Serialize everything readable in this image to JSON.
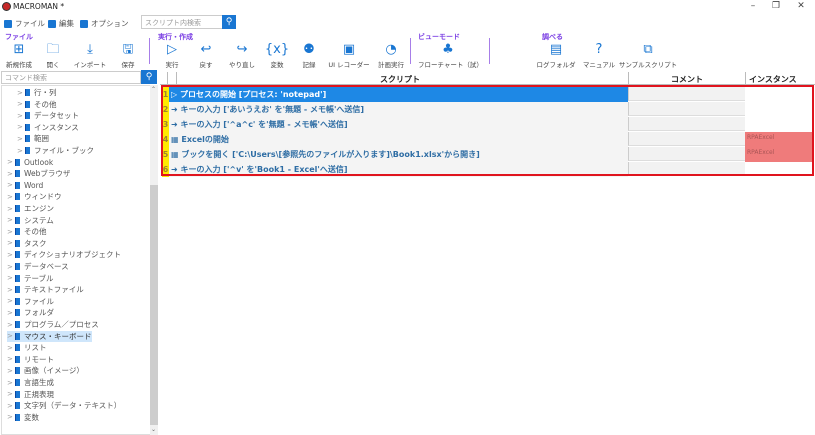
{
  "window": {
    "title": "MACROMAN *",
    "min": "–",
    "max": "❐",
    "close": "✕"
  },
  "menu": [
    {
      "label": "ファイル"
    },
    {
      "label": "編集"
    },
    {
      "label": "オプション"
    }
  ],
  "script_search": {
    "placeholder": "スクリプト内検索",
    "icon": "search-icon"
  },
  "groups": {
    "file": "ファイル",
    "run": "実行・作成",
    "view": "ビューモード",
    "lookup": "調べる"
  },
  "toolbar": [
    {
      "label": "新規作成",
      "icon": "new-file-icon",
      "glyph": "⊞"
    },
    {
      "label": "開く",
      "icon": "open-folder-icon",
      "glyph": "🗀"
    },
    {
      "label": "インポート",
      "icon": "import-icon",
      "glyph": "⤓"
    },
    {
      "label": "保存",
      "icon": "save-icon",
      "glyph": "🖫"
    },
    {
      "label": "実行",
      "icon": "play-icon",
      "glyph": "▷"
    },
    {
      "label": "戻す",
      "icon": "undo-icon",
      "glyph": "↩"
    },
    {
      "label": "やり直し",
      "icon": "redo-icon",
      "glyph": "↪"
    },
    {
      "label": "変数",
      "icon": "variable-icon",
      "glyph": "{x}"
    },
    {
      "label": "記録",
      "icon": "record-icon",
      "glyph": "⚉"
    },
    {
      "label": "UI レコーダー",
      "icon": "ui-recorder-icon",
      "glyph": "▣"
    },
    {
      "label": "計画実行",
      "icon": "schedule-icon",
      "glyph": "◔"
    },
    {
      "label": "フローチャート（試）",
      "icon": "flowchart-icon",
      "glyph": "♣"
    },
    {
      "label": "ログフォルダ",
      "icon": "log-folder-icon",
      "glyph": "▤"
    },
    {
      "label": "マニュアル",
      "icon": "help-icon",
      "glyph": "?"
    },
    {
      "label": "サンプルスクリプト",
      "icon": "sample-script-icon",
      "glyph": "⧉"
    }
  ],
  "command_search": {
    "placeholder": "コマンド検索"
  },
  "tree": [
    {
      "label": "行・列",
      "level": 1
    },
    {
      "label": "その他",
      "level": 1
    },
    {
      "label": "データセット",
      "level": 1
    },
    {
      "label": "インスタンス",
      "level": 1
    },
    {
      "label": "範囲",
      "level": 1
    },
    {
      "label": "ファイル・ブック",
      "level": 1
    },
    {
      "label": "Outlook",
      "level": 0
    },
    {
      "label": "Webブラウザ",
      "level": 0
    },
    {
      "label": "Word",
      "level": 0
    },
    {
      "label": "ウィンドウ",
      "level": 0
    },
    {
      "label": "エンジン",
      "level": 0
    },
    {
      "label": "システム",
      "level": 0
    },
    {
      "label": "その他",
      "level": 0
    },
    {
      "label": "タスク",
      "level": 0
    },
    {
      "label": "ディクショナリオブジェクト",
      "level": 0
    },
    {
      "label": "データベース",
      "level": 0
    },
    {
      "label": "テーブル",
      "level": 0
    },
    {
      "label": "テキストファイル",
      "level": 0
    },
    {
      "label": "ファイル",
      "level": 0
    },
    {
      "label": "フォルダ",
      "level": 0
    },
    {
      "label": "プログラム／プロセス",
      "level": 0
    },
    {
      "label": "マウス・キーボード",
      "level": 0,
      "selected": true
    },
    {
      "label": "リスト",
      "level": 0
    },
    {
      "label": "リモート",
      "level": 0
    },
    {
      "label": "画像（イメージ）",
      "level": 0
    },
    {
      "label": "言語生成",
      "level": 0
    },
    {
      "label": "正規表現",
      "level": 0
    },
    {
      "label": "文字列（データ・テキスト）",
      "level": 0
    },
    {
      "label": "変数",
      "level": 0
    }
  ],
  "grid": {
    "headers": {
      "script": "スクリプト",
      "comment": "コメント",
      "instance": "インスタンス"
    },
    "rows": [
      {
        "num": "1",
        "icon": "process-start-icon",
        "glyph": "▷",
        "script": "プロセスの開始 [プロセス: 'notepad']",
        "comment": "",
        "instance": "",
        "selected": true
      },
      {
        "num": "2",
        "icon": "arrow-right-icon",
        "glyph": "➜",
        "script": "キーの入力 ['あいうえお' を'無題 - メモ帳'へ送信]",
        "comment": "",
        "instance": ""
      },
      {
        "num": "3",
        "icon": "arrow-right-icon",
        "glyph": "➜",
        "script": "キーの入力 ['^a^c' を'無題 - メモ帳'へ送信]",
        "comment": "",
        "instance": ""
      },
      {
        "num": "4",
        "icon": "excel-grid-icon",
        "glyph": "▦",
        "script": "Excelの開始",
        "comment": "",
        "instance": "RPAExcel"
      },
      {
        "num": "5",
        "icon": "excel-grid-icon",
        "glyph": "▦",
        "script": "ブックを開く ['C:\\Users\\[参照先のファイルが入ります]\\Book1.xlsx'から開き]",
        "comment": "",
        "instance": "RPAExcel"
      },
      {
        "num": "6",
        "icon": "arrow-right-icon",
        "glyph": "➜",
        "script": "キーの入力 ['^v' を'Book1 - Excel'へ送信]",
        "comment": "",
        "instance": ""
      }
    ]
  },
  "colors": {
    "accent": "#1976d2",
    "selection": "#1e88e5",
    "highlight_border": "#e0141e",
    "instance_highlight": "#ef7b7b",
    "line_number_bg": "#ffea00"
  }
}
